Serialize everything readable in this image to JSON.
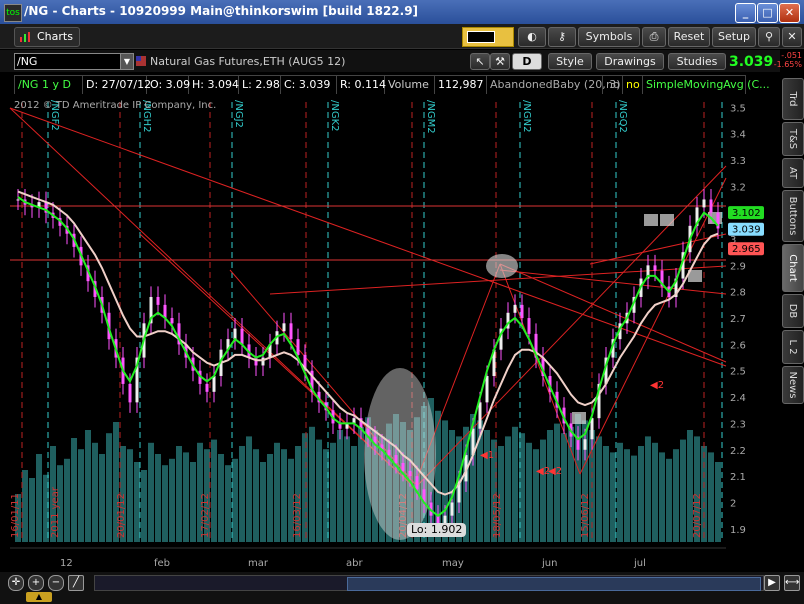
{
  "window": {
    "title": "/NG - Charts - 10920999 Main@thinkorswim [build 1822.9]",
    "controls": [
      "_",
      "□",
      "✕"
    ]
  },
  "toolbar": {
    "tab_label": "Charts",
    "buttons": {
      "symbols": "Symbols",
      "reset": "Reset",
      "setup": "Setup"
    }
  },
  "symbol": {
    "value": "/NG",
    "description": "Natural Gas Futures,ETH (AUG5 12)",
    "aggregation": "D",
    "style_label": "Style",
    "drawings_label": "Drawings",
    "studies_label": "Studies",
    "last": "3.039",
    "netchg": "-.051",
    "pctchg": "-1.65%"
  },
  "info": {
    "instrument": "/NG 1 y D",
    "date": "D: 27/07/12",
    "open": "O: 3.09",
    "high": "H: 3.094",
    "low": "L: 2.98",
    "close": "C: 3.039",
    "range": "R: 0.114",
    "volume_label": "Volume",
    "volume": "112,987",
    "study1": "AbandonedBaby (20, 3)",
    "no1": "no",
    "no2": "no",
    "study2": "SimpleMovingAvg (C..."
  },
  "chart_data": {
    "type": "line",
    "title": "",
    "copyright": "2012 © TD Ameritrade IP Company, Inc.",
    "y_ticks": [
      "3.5",
      "3.4",
      "3.3",
      "3.2",
      "3.1",
      "3",
      "2.9",
      "2.8",
      "2.7",
      "2.6",
      "2.5",
      "2.4",
      "2.3",
      "2.2",
      "2.1",
      "2",
      "1.9"
    ],
    "ylim": [
      1.85,
      3.52
    ],
    "x_month_labels": [
      "12",
      "feb",
      "mar",
      "abr",
      "may",
      "jun",
      "jul"
    ],
    "expiration_labels": [
      "/NGF2",
      "/NGH2",
      "/NGJ2",
      "/NGK2",
      "/NGM2",
      "/NGN2",
      "/NGQ2"
    ],
    "date_markers": [
      "16/01/11",
      "2011 year",
      "20/01/12",
      "17/02/12",
      "16/03/12",
      "20/04/12",
      "18/05/12",
      "15/06/12",
      "20/07/12"
    ],
    "price_badges": [
      "3.102",
      "3.039",
      "2.965"
    ],
    "price_badge_colors": [
      "#22dd22",
      "#88ddff",
      "#ff5555"
    ],
    "low_label": "Lo: 1.902",
    "annotations": [
      "2",
      "1",
      "2",
      "2"
    ],
    "close_series": [
      3.15,
      3.13,
      3.12,
      3.14,
      3.1,
      3.08,
      3.05,
      3.02,
      2.97,
      2.9,
      2.84,
      2.78,
      2.72,
      2.62,
      2.55,
      2.45,
      2.38,
      2.55,
      2.68,
      2.78,
      2.75,
      2.7,
      2.68,
      2.6,
      2.55,
      2.5,
      2.45,
      2.42,
      2.48,
      2.58,
      2.62,
      2.66,
      2.6,
      2.55,
      2.52,
      2.55,
      2.6,
      2.65,
      2.68,
      2.62,
      2.56,
      2.5,
      2.42,
      2.38,
      2.35,
      2.3,
      2.28,
      2.3,
      2.32,
      2.28,
      2.25,
      2.22,
      2.2,
      2.18,
      2.15,
      2.12,
      2.1,
      2.05,
      2.0,
      1.95,
      1.92,
      1.95,
      2.0,
      2.08,
      2.18,
      2.28,
      2.38,
      2.48,
      2.58,
      2.66,
      2.72,
      2.75,
      2.7,
      2.64,
      2.55,
      2.48,
      2.42,
      2.36,
      2.3,
      2.25,
      2.2,
      2.24,
      2.32,
      2.45,
      2.55,
      2.62,
      2.68,
      2.72,
      2.78,
      2.85,
      2.9,
      2.88,
      2.82,
      2.78,
      2.85,
      2.95,
      3.05,
      3.12,
      3.15,
      3.1,
      3.04
    ],
    "ma_fast": [
      3.16,
      3.14,
      3.13,
      3.12,
      3.11,
      3.09,
      3.07,
      3.04,
      3.0,
      2.94,
      2.88,
      2.82,
      2.75,
      2.66,
      2.58,
      2.5,
      2.46,
      2.52,
      2.62,
      2.7,
      2.72,
      2.7,
      2.67,
      2.62,
      2.57,
      2.52,
      2.48,
      2.46,
      2.48,
      2.54,
      2.58,
      2.62,
      2.6,
      2.57,
      2.55,
      2.56,
      2.6,
      2.63,
      2.64,
      2.6,
      2.55,
      2.49,
      2.43,
      2.39,
      2.36,
      2.32,
      2.3,
      2.3,
      2.3,
      2.28,
      2.25,
      2.22,
      2.2,
      2.17,
      2.14,
      2.11,
      2.08,
      2.04,
      2.0,
      1.97,
      1.95,
      1.97,
      2.02,
      2.1,
      2.2,
      2.3,
      2.4,
      2.5,
      2.58,
      2.64,
      2.68,
      2.7,
      2.67,
      2.62,
      2.56,
      2.5,
      2.44,
      2.38,
      2.32,
      2.27,
      2.24,
      2.26,
      2.33,
      2.43,
      2.52,
      2.6,
      2.66,
      2.7,
      2.76,
      2.82,
      2.86,
      2.86,
      2.83,
      2.8,
      2.84,
      2.92,
      3.0,
      3.06,
      3.1,
      3.08,
      3.05
    ],
    "ma_slow": [
      3.18,
      3.17,
      3.16,
      3.15,
      3.14,
      3.13,
      3.11,
      3.09,
      3.06,
      3.02,
      2.98,
      2.94,
      2.89,
      2.83,
      2.77,
      2.71,
      2.66,
      2.63,
      2.63,
      2.64,
      2.65,
      2.65,
      2.64,
      2.62,
      2.6,
      2.57,
      2.55,
      2.53,
      2.52,
      2.53,
      2.54,
      2.56,
      2.56,
      2.55,
      2.54,
      2.54,
      2.55,
      2.56,
      2.57,
      2.56,
      2.54,
      2.51,
      2.48,
      2.45,
      2.42,
      2.39,
      2.36,
      2.34,
      2.33,
      2.31,
      2.29,
      2.27,
      2.25,
      2.23,
      2.21,
      2.18,
      2.16,
      2.13,
      2.1,
      2.07,
      2.04,
      2.03,
      2.04,
      2.07,
      2.12,
      2.18,
      2.25,
      2.32,
      2.39,
      2.45,
      2.51,
      2.56,
      2.58,
      2.58,
      2.57,
      2.55,
      2.52,
      2.49,
      2.45,
      2.41,
      2.38,
      2.37,
      2.38,
      2.41,
      2.45,
      2.5,
      2.55,
      2.59,
      2.63,
      2.68,
      2.72,
      2.75,
      2.76,
      2.77,
      2.79,
      2.83,
      2.88,
      2.93,
      2.98,
      3.01,
      3.02
    ],
    "volume_series": [
      0.3,
      0.45,
      0.4,
      0.55,
      0.42,
      0.6,
      0.48,
      0.52,
      0.65,
      0.58,
      0.7,
      0.62,
      0.55,
      0.68,
      0.75,
      0.6,
      0.58,
      0.5,
      0.45,
      0.62,
      0.55,
      0.48,
      0.52,
      0.6,
      0.56,
      0.5,
      0.62,
      0.58,
      0.64,
      0.55,
      0.48,
      0.52,
      0.6,
      0.66,
      0.58,
      0.5,
      0.55,
      0.62,
      0.58,
      0.52,
      0.6,
      0.68,
      0.72,
      0.64,
      0.58,
      0.62,
      0.7,
      0.66,
      0.6,
      0.72,
      0.78,
      0.7,
      0.66,
      0.74,
      0.8,
      0.75,
      0.7,
      0.78,
      0.85,
      0.9,
      0.82,
      0.76,
      0.7,
      0.66,
      0.72,
      0.8,
      0.76,
      0.7,
      0.64,
      0.6,
      0.66,
      0.72,
      0.68,
      0.62,
      0.58,
      0.64,
      0.7,
      0.74,
      0.68,
      0.72,
      0.8,
      0.76,
      0.7,
      0.66,
      0.6,
      0.56,
      0.62,
      0.58,
      0.54,
      0.6,
      0.66,
      0.62,
      0.56,
      0.52,
      0.58,
      0.64,
      0.7,
      0.66,
      0.6,
      0.56,
      0.5
    ]
  },
  "side_tabs": [
    "Trd",
    "T&S",
    "AT",
    "Buttons",
    "Chart",
    "DB",
    "L 2",
    "News"
  ],
  "colors": {
    "ma_fast": "#22ee22",
    "ma_slow": "#f0d0c8",
    "price": "#ff55ff",
    "volume": "#1f5f5f",
    "trendline": "#dd2222"
  }
}
